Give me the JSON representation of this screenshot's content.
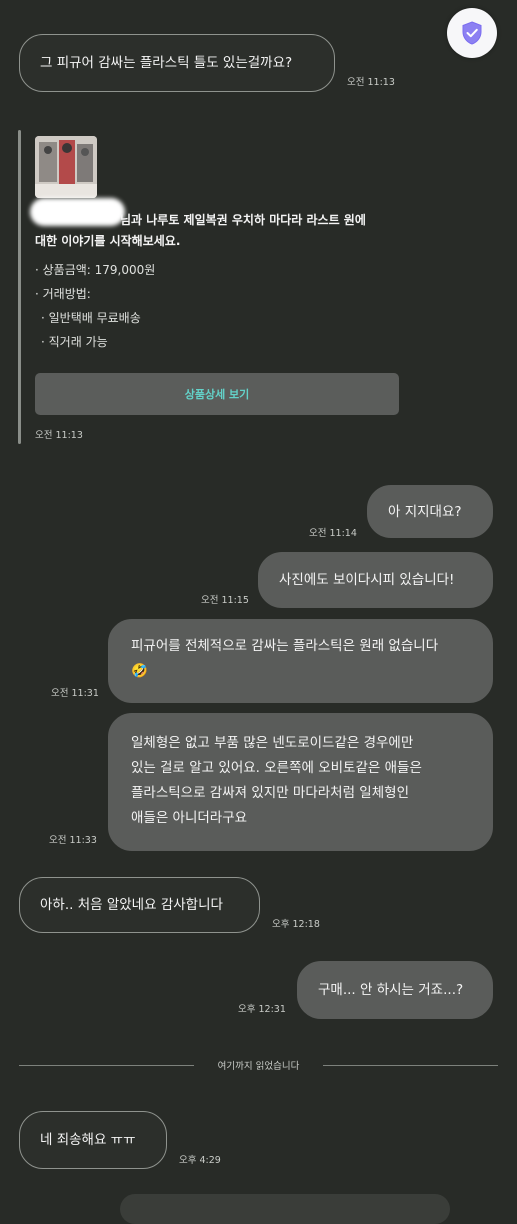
{
  "messages": [
    {
      "text": "그 피규어 감싸는 플라스틱 틀도 있는걸까요?",
      "time": "오전 11:13"
    },
    {
      "text": "아 지지대요?",
      "time": "오전 11:14"
    },
    {
      "text": "사진에도 보이다시피 있습니다!",
      "time": "오전 11:15"
    },
    {
      "lines": [
        "피규어를 전체적으로 감싸는 플라스틱은 원래 없습니다",
        "🤣"
      ],
      "time": "오전 11:31"
    },
    {
      "lines": [
        "일체형은 없고 부품 많은 넨도로이드같은 경우에만",
        "있는 걸로 알고 있어요. 오른쪽에 오비토같은 애들은",
        "플라스틱으로 감싸져 있지만 마다라처럼 일체형인",
        "애들은 아니더라구요"
      ],
      "time": "오전 11:33"
    },
    {
      "text": "아하.. 처음 알았네요 감사합니다",
      "time": "오후 12:18"
    },
    {
      "text": "구매... 안 하시는 거죠...?",
      "time": "오후 12:31"
    },
    {
      "text": "네 죄송해요 ㅠㅠ",
      "time": "오후 4:29"
    }
  ],
  "product_card": {
    "title_line1": "님과 나루토 제일복권 우치하 마다라 라스트 원에",
    "title_line2": "대한 이야기를 시작해보세요.",
    "price": "· 상품금액: 179,000원",
    "method_label": "· 거래방법:",
    "method_1": "· 일반택배 무료배송",
    "method_2": "· 직거래 가능",
    "button_label": "상품상세 보기",
    "time": "오전 11:13"
  },
  "read_divider": "여기까지 읽었습니다",
  "icons": {
    "safety": "shield-check-icon",
    "thumbnail": "product-thumbnail"
  },
  "colors": {
    "background": "#282b27",
    "my_bubble": "#5a5c5a",
    "accent": "#63d2c9",
    "shield": "#7b6cf0"
  }
}
